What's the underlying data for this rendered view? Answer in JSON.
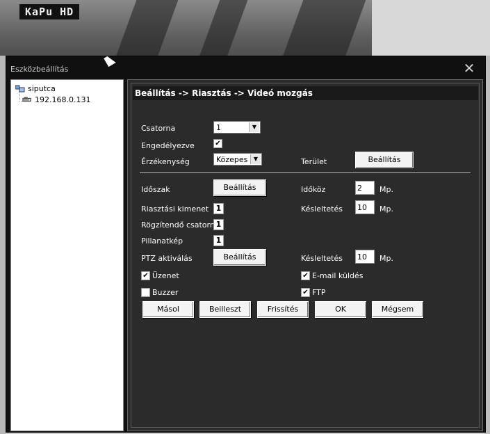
{
  "camera": {
    "label": "KaPu HD"
  },
  "window": {
    "title": "Eszközbeállítás",
    "close_icon": "close-icon"
  },
  "tree": {
    "root": {
      "label": "siputca",
      "icon": "group-icon"
    },
    "device": {
      "label": "192.168.0.131",
      "icon": "device-icon"
    }
  },
  "breadcrumb": "Beállítás -> Riasztás -> Videó mozgás",
  "form": {
    "channel": {
      "label": "Csatorna",
      "value": "1"
    },
    "enabled": {
      "label": "Engedélyezve",
      "checked": true
    },
    "sensitivity": {
      "label": "Érzékenység",
      "value": "Közepes"
    },
    "region": {
      "label": "Terület",
      "button": "Beállítás"
    },
    "period": {
      "label": "Időszak",
      "button": "Beállítás"
    },
    "interval": {
      "label": "Időköz",
      "value": "2",
      "unit": "Mp."
    },
    "alarm_output": {
      "label": "Riasztási kimenet",
      "value": "1"
    },
    "delay1": {
      "label": "Késleltetés",
      "value": "10",
      "unit": "Mp."
    },
    "record_channel": {
      "label": "Rögzítendő csatorna",
      "value": "1"
    },
    "snapshot": {
      "label": "Pillanatkép",
      "value": "1"
    },
    "ptz": {
      "label": "PTZ aktiválás",
      "button": "Beállítás"
    },
    "delay2": {
      "label": "Késleltetés",
      "value": "10",
      "unit": "Mp."
    },
    "message": {
      "label": "Üzenet",
      "checked": true
    },
    "email": {
      "label": "E-mail küldés",
      "checked": true
    },
    "buzzer": {
      "label": "Buzzer",
      "checked": false
    },
    "ftp": {
      "label": "FTP",
      "checked": true
    }
  },
  "actions": {
    "copy": "Másol",
    "paste": "Beilleszt",
    "refresh": "Frissítés",
    "ok": "OK",
    "cancel": "Mégsem"
  }
}
